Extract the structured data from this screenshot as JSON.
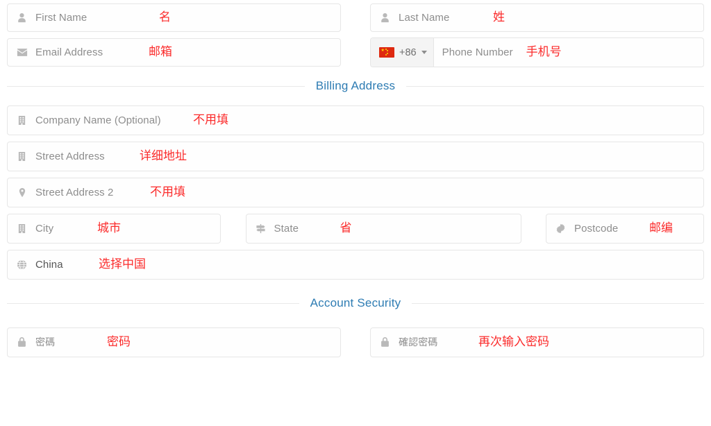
{
  "form": {
    "rows": {
      "first_name": {
        "placeholder": "First Name",
        "icon": "user-icon",
        "note": "名"
      },
      "last_name": {
        "placeholder": "Last Name",
        "icon": "user-icon",
        "note": "姓"
      },
      "email": {
        "placeholder": "Email Address",
        "icon": "envelope-icon",
        "note": "邮箱"
      },
      "phone": {
        "placeholder": "Phone Number",
        "dial_code": "+86",
        "flag": "china-flag-icon",
        "note": "手机号"
      },
      "company": {
        "placeholder": "Company Name (Optional)",
        "icon": "building-icon",
        "note": "不用填"
      },
      "street1": {
        "placeholder": "Street Address",
        "icon": "building-icon",
        "note": "详细地址"
      },
      "street2": {
        "placeholder": "Street Address 2",
        "icon": "map-pin-icon",
        "note": "不用填"
      },
      "city": {
        "placeholder": "City",
        "icon": "building-icon",
        "note": "城市"
      },
      "state": {
        "placeholder": "State",
        "icon": "signpost-icon",
        "note": "省"
      },
      "postcode": {
        "placeholder": "Postcode",
        "icon": "gear-icon",
        "note": "邮编"
      },
      "country": {
        "value": "China",
        "icon": "globe-icon",
        "note": "选择中国"
      },
      "password": {
        "placeholder": "密碼",
        "icon": "lock-icon",
        "note": "密码"
      },
      "confirm_password": {
        "placeholder": "確認密碼",
        "icon": "lock-icon",
        "note": "再次输入密码"
      }
    },
    "sections": {
      "billing_address": "Billing Address",
      "account_security": "Account Security"
    }
  },
  "colors": {
    "section_title": "#2e7cb3",
    "annotation_red": "#fb2b2b",
    "placeholder_gray": "#8d8d8d",
    "field_border": "#e6e6e6",
    "flag_red": "#de2910",
    "flag_yellow": "#ffde00"
  }
}
